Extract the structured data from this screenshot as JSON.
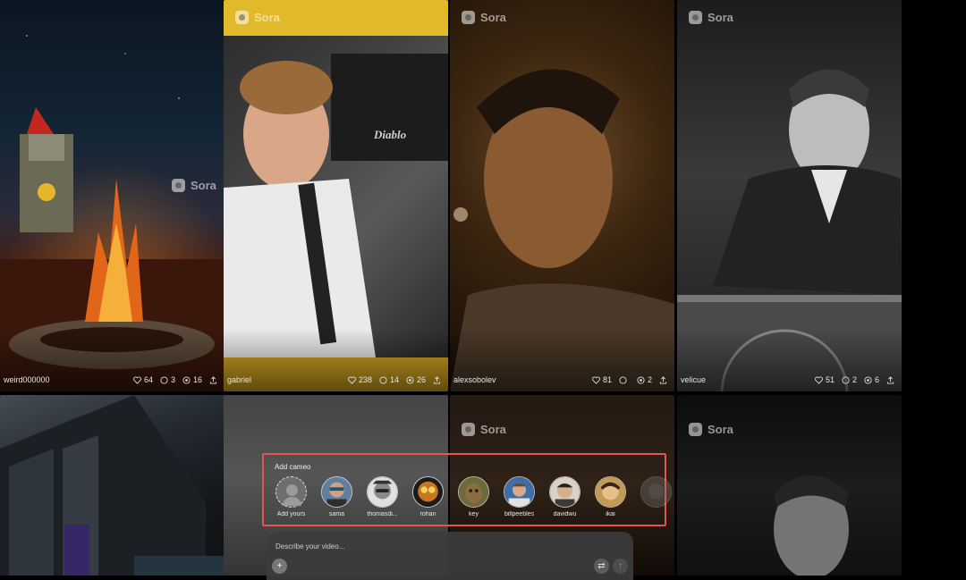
{
  "watermark": "Sora",
  "tiles_top": [
    {
      "user": "weird000000",
      "likes": "64",
      "comments": "3",
      "remixes": "16"
    },
    {
      "user": "gabriel",
      "likes": "238",
      "comments": "14",
      "remixes": "26"
    },
    {
      "user": "alexsobolev",
      "likes": "81",
      "comments": "",
      "remixes": "2"
    },
    {
      "user": "velicue",
      "likes": "51",
      "comments": "2",
      "remixes": "6"
    }
  ],
  "tile_texts": {
    "car_badge": "Diablo"
  },
  "cameo": {
    "title": "Add cameo",
    "add_label": "Add yours",
    "people": [
      {
        "name": "sama",
        "color": "#5d7fa0"
      },
      {
        "name": "thomasdi...",
        "color": "#e0e0e0"
      },
      {
        "name": "rohan",
        "color": "#c9741f"
      },
      {
        "name": "key",
        "color": "#6e6a3a"
      },
      {
        "name": "billpeebles",
        "color": "#3d6ea8"
      },
      {
        "name": "davidwu",
        "color": "#d9d2c6"
      },
      {
        "name": "ikai",
        "color": "#c49a56"
      }
    ]
  },
  "composer": {
    "placeholder": "Describe your video...",
    "plus": "+",
    "swap": "⇄",
    "send": "↑"
  }
}
